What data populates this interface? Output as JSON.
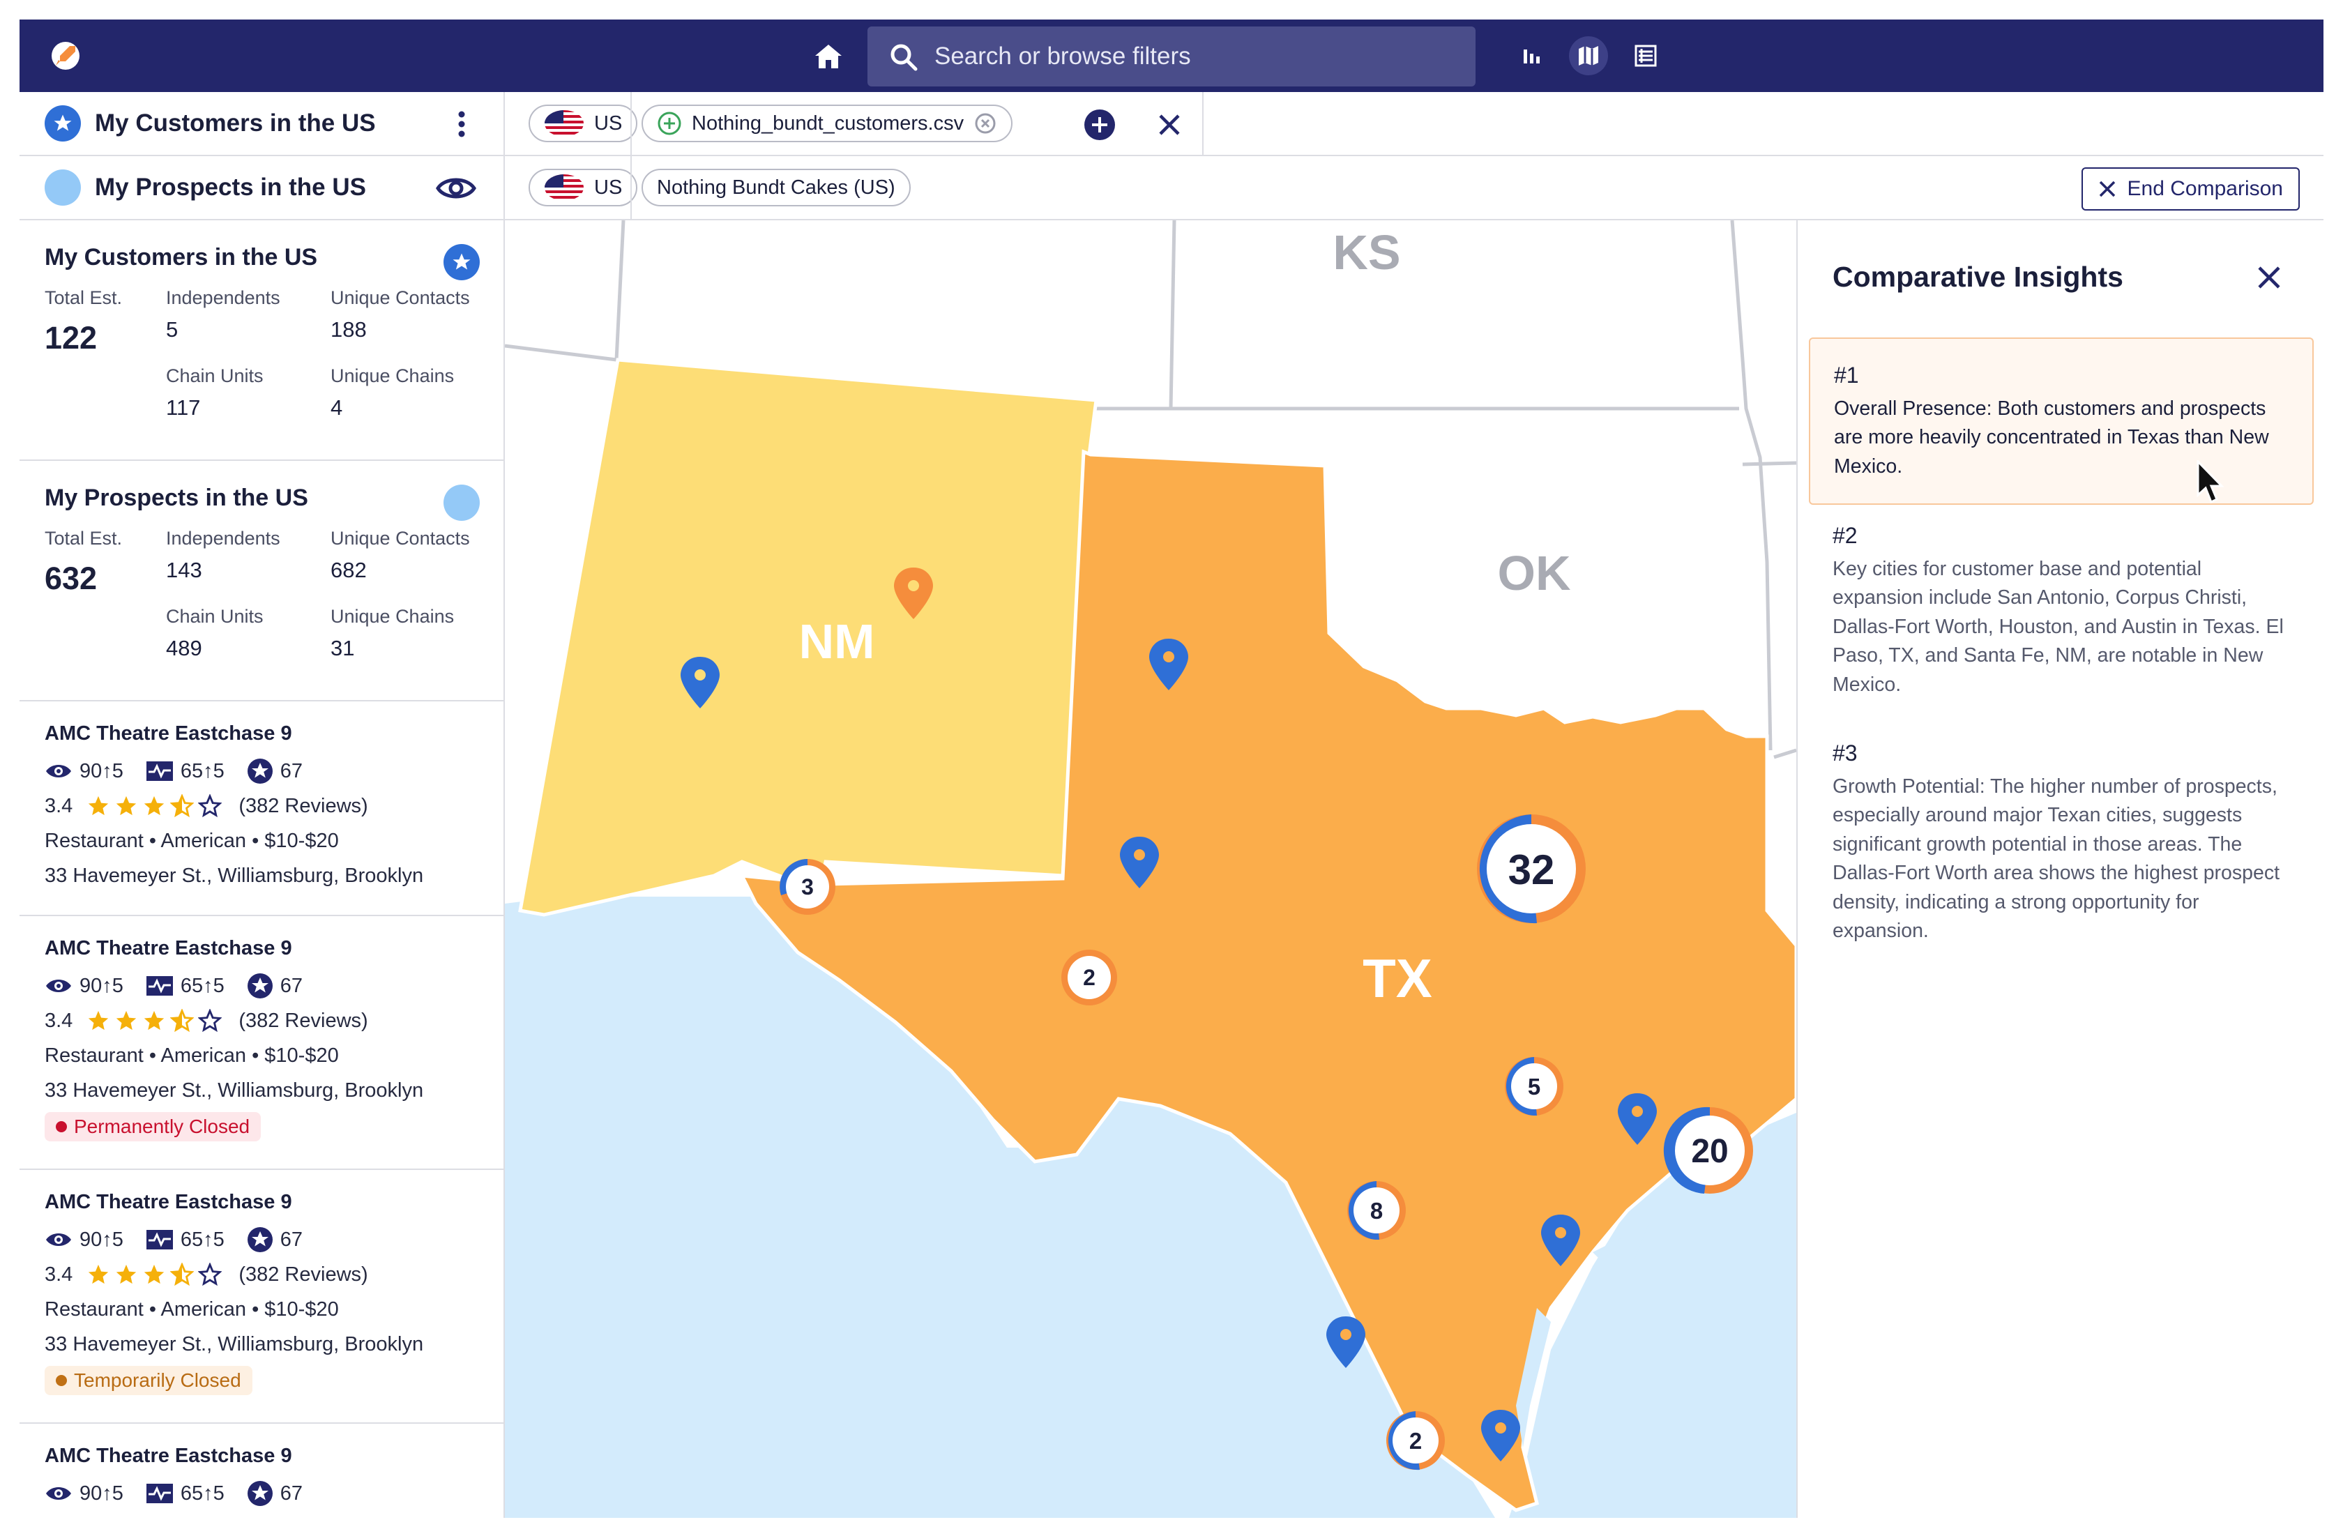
{
  "topbar": {
    "logo": "rocket-logo-icon",
    "search_placeholder": "Search or browse filters",
    "icons": [
      "home-icon",
      "bar-chart-icon",
      "map-icon",
      "table-icon"
    ]
  },
  "sidebar": {
    "lists": [
      {
        "label": "My Customers in the US",
        "icon": "star-icon",
        "color": "#2f6fd6"
      },
      {
        "label": "My Prospects in the US",
        "icon": "eye-icon",
        "color": "#94c9f7"
      }
    ],
    "summaries": [
      {
        "title": "My Customers in the US",
        "color": "#2f6fd6",
        "total_label": "Total Est.",
        "total": "122",
        "independents_label": "Independents",
        "independents": "5",
        "contacts_label": "Unique Contacts",
        "contacts": "188",
        "chain_units_label": "Chain Units",
        "chain_units": "117",
        "chains_label": "Unique Chains",
        "chains": "4"
      },
      {
        "title": "My Prospects in the US",
        "color": "#94c9f7",
        "total_label": "Total Est.",
        "total": "632",
        "independents_label": "Independents",
        "independents": "143",
        "contacts_label": "Unique Contacts",
        "contacts": "682",
        "chain_units_label": "Chain Units",
        "chain_units": "489",
        "chains_label": "Unique Chains",
        "chains": "31"
      }
    ],
    "places": [
      {
        "name": "AMC Theatre Eastchase 9",
        "views": "90↑5",
        "activity": "65↑5",
        "score": "67",
        "rating": 3.5,
        "rating_text": "3.4",
        "reviews": "(382 Reviews)",
        "category": "Restaurant • American • $10-$20",
        "address": "33 Havemeyer St., Williamsburg, Brooklyn",
        "status": ""
      },
      {
        "name": "AMC Theatre Eastchase 9",
        "views": "90↑5",
        "activity": "65↑5",
        "score": "67",
        "rating": 3.5,
        "rating_text": "3.4",
        "reviews": "(382 Reviews)",
        "category": "Restaurant • American • $10-$20",
        "address": "33 Havemeyer St., Williamsburg, Brooklyn",
        "status": "Permanently Closed"
      },
      {
        "name": "AMC Theatre Eastchase 9",
        "views": "90↑5",
        "activity": "65↑5",
        "score": "67",
        "rating": 3.5,
        "rating_text": "3.4",
        "reviews": "(382 Reviews)",
        "category": "Restaurant • American • $10-$20",
        "address": "33 Havemeyer St., Williamsburg, Brooklyn",
        "status": "Temporarily Closed"
      },
      {
        "name": "AMC Theatre Eastchase 9",
        "views": "90↑5",
        "activity": "65↑5",
        "score": "67"
      }
    ]
  },
  "filters": {
    "row1": {
      "region": "US",
      "file": "Nothing_bundt_customers.csv"
    },
    "row2": {
      "region": "US",
      "brand": "Nothing Bundt Cakes (US)",
      "end_label": "End Comparison"
    }
  },
  "map": {
    "states": {
      "ks": "KS",
      "ok": "OK",
      "nm": "NM",
      "tx": "TX"
    },
    "clusters": [
      "3",
      "2",
      "32",
      "5",
      "20",
      "8",
      "2"
    ],
    "colors": {
      "texas": "#fbad4b",
      "new_mexico": "#fddd76",
      "water": "#d3ebfc",
      "customer": "#2f6fd6",
      "prospect": "#f58d3c"
    }
  },
  "insights": {
    "title": "Comparative Insights",
    "items": [
      {
        "num": "#1",
        "text": "Overall Presence: Both customers and prospects are more heavily concentrated in Texas than New Mexico."
      },
      {
        "num": "#2",
        "text": "Key cities for customer base and potential expansion include San Antonio, Corpus Christi, Dallas-Fort Worth, Houston, and Austin in Texas. El Paso, TX, and Santa Fe, NM, are notable in New Mexico."
      },
      {
        "num": "#3",
        "text": "Growth Potential: The higher number of prospects, especially around major Texan cities, suggests significant growth potential in those areas. The Dallas-Fort Worth area shows the highest prospect density, indicating a strong opportunity for expansion."
      }
    ]
  }
}
